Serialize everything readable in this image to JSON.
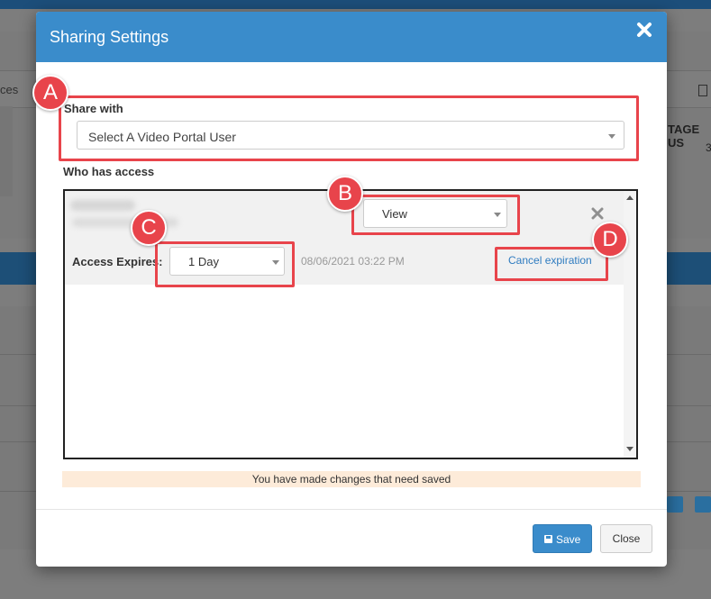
{
  "background": {
    "left_text": "ces",
    "right_text": "TAGE US",
    "right_subtext": "3"
  },
  "modal": {
    "title": "Sharing Settings",
    "share_with_label": "Share with",
    "user_select_placeholder": "Select A Video Portal User",
    "who_has_access_label": "Who has access",
    "access_entry": {
      "permission": "View",
      "access_expires_label": "Access Expires:",
      "expiration_option": "1 Day",
      "expiration_date": "08/06/2021 03:22 PM",
      "cancel_expiration_link": "Cancel expiration"
    },
    "notice": "You have made changes that need saved",
    "save_label": "Save",
    "close_label": "Close"
  },
  "callouts": {
    "a": "A",
    "b": "B",
    "c": "C",
    "d": "D"
  },
  "colors": {
    "header_blue": "#3a8ccb",
    "callout_red": "#e8444b",
    "link_blue": "#2f7cc0",
    "notice_bg": "#fdebd9"
  },
  "icons": {
    "close": "close-icon",
    "remove_user": "remove-user-icon",
    "save": "floppy-disk-icon",
    "dropdown": "caret-down-icon"
  }
}
